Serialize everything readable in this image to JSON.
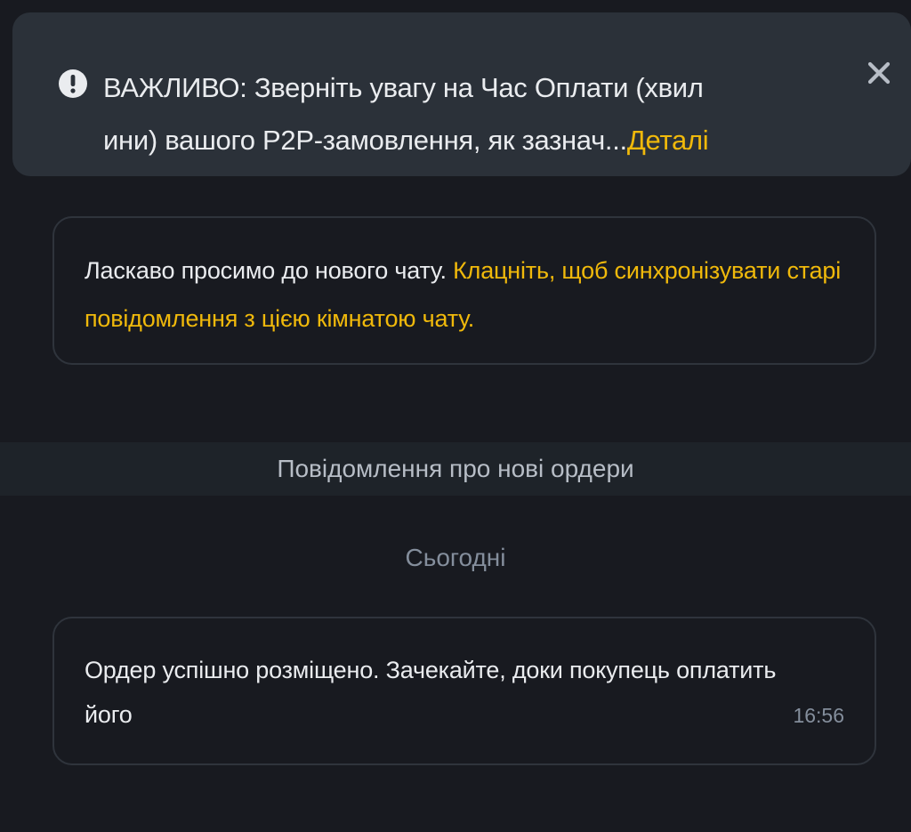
{
  "notice": {
    "warning_line1": "ВАЖЛИВО: Зверніть увагу на Час Оплати (хвил",
    "warning_line2": "ини) вашого P2P-замовлення, як зазнач...",
    "details_link": "Деталі",
    "icon": "exclamation-circle-icon",
    "close_icon": "close-icon"
  },
  "welcome": {
    "text": "Ласкаво просимо до нового чату. ",
    "sync_link": "Клацніть, щоб синхронізувати старі повідомлення з цією кімнатою чату."
  },
  "section_title": "Повідомлення про нові ордери",
  "date_label": "Сьогодні",
  "message": {
    "text": "Ордер успішно розміщено. Зачекайте, доки покупець оплатить його",
    "time": "16:56"
  },
  "colors": {
    "background": "#181a20",
    "notice_background": "#2b3139",
    "accent": "#f0b90b",
    "text_primary": "#eaecef",
    "text_secondary": "#848e9c"
  }
}
